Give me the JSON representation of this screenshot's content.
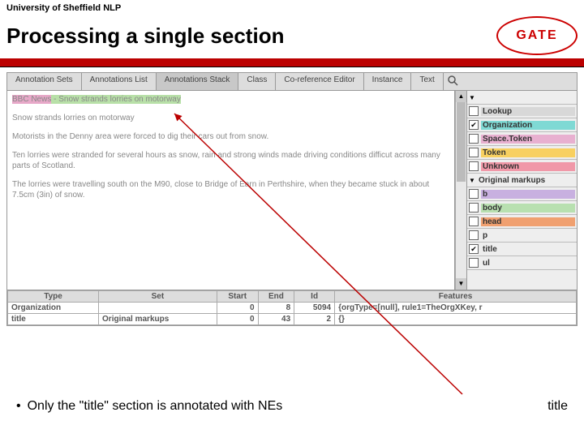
{
  "header": {
    "institution": "University of Sheffield NLP",
    "logo_text": "GATE"
  },
  "title": "Processing a single section",
  "tabs": [
    "Annotation Sets",
    "Annotations List",
    "Annotations Stack",
    "Class",
    "Co-reference Editor",
    "Instance",
    "Text"
  ],
  "doc": {
    "title_prefix": "BBC News",
    "title_suffix": " - Snow strands lorries on motorway",
    "p1": "Snow strands lorries on motorway",
    "p2": "Motorists in the Denny area were forced to dig their cars out from snow.",
    "p3": "Ten lorries were stranded for several hours as snow, rain and strong winds made driving conditions difficut across many parts of Scotland.",
    "p4": "The lorries were travelling south on the M90, close to Bridge of Earn in Perthshire, when they became stuck in about 7.5cm (3in) of snow."
  },
  "side": {
    "groups": [
      {
        "label": "",
        "expanded": true
      },
      {
        "label": "Lookup",
        "color": "c-lookup",
        "checked": false
      },
      {
        "label": "Organization",
        "color": "c-org",
        "checked": true
      },
      {
        "label": "Space.Token",
        "color": "c-space",
        "checked": false
      },
      {
        "label": "Token",
        "color": "c-token",
        "checked": false
      },
      {
        "label": "Unknown",
        "color": "c-unk",
        "checked": false
      }
    ],
    "orig_header": "Original markups",
    "orig": [
      {
        "label": "b",
        "color": "c-b",
        "checked": false
      },
      {
        "label": "body",
        "color": "c-body",
        "checked": false
      },
      {
        "label": "head",
        "color": "c-head",
        "checked": false
      },
      {
        "label": "p",
        "color": "c-p",
        "checked": false
      },
      {
        "label": "title",
        "color": "c-title",
        "checked": true
      },
      {
        "label": "ul",
        "color": "c-ul",
        "checked": false
      }
    ]
  },
  "table": {
    "headers": [
      "Type",
      "Set",
      "Start",
      "End",
      "Id",
      "Features"
    ],
    "rows": [
      [
        "Organization",
        "",
        "0",
        "8",
        "5094",
        "{orgType=[null], rule1=TheOrgXKey, r"
      ],
      [
        "title",
        "Original markups",
        "0",
        "43",
        "2",
        "{}"
      ]
    ]
  },
  "bullet": "Only the \"title\" section is annotated with NEs",
  "aside_label": "title"
}
